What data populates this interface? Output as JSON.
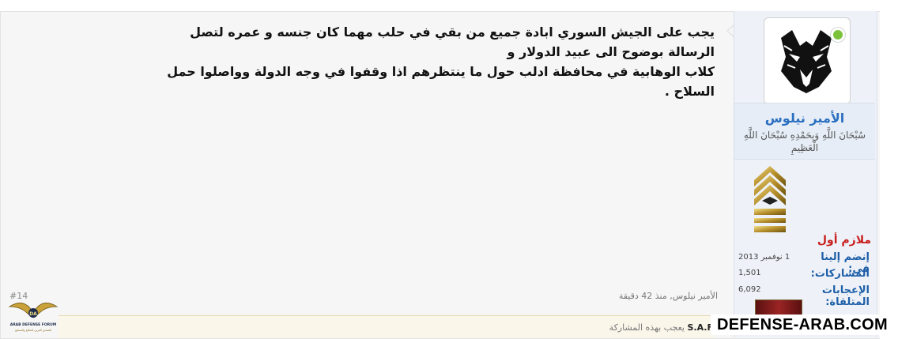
{
  "post": {
    "message_line1": "يجب على الجيش السوري ابادة جميع من بقي في حلب مهما كان جنسه و عمره لتصل الرسالة بوضوح الى عبيد الدولار و",
    "message_line2": "كلاب الوهابية في محافظة ادلب حول ما ينتظرهم اذا وقفوا في وجه الدولة وواصلوا حمل السلاح .",
    "post_number": "#14",
    "author_time": "الأمير نيلوس, منذ 42 دقيقة",
    "likes_user": "S.A.F",
    "likes_suffix": "يعجب بهذه المشاركة"
  },
  "user": {
    "name": "الأمير نيلوس",
    "title": "سُبْحَانَ اللَّهِ وَبِحَمْدِهِ سُبْحَانَ اللَّهِ الْعَظِيمِ",
    "rank": "ملازم أول",
    "stats": {
      "joined_label": "إنضم إلينا في:",
      "joined_value": "1 نوفمبر 2013",
      "posts_label": "المشاركات:",
      "posts_value": "1,501",
      "likes_label": "الإعجابات المتلقاة:",
      "likes_value": "6,092"
    },
    "online": true
  },
  "branding": {
    "watermark": "DEFENSE-ARAB.COM",
    "logo_text": "ARAB DEFENSE FORUM",
    "logo_subtext": "المنتدى العربي للدفاع والتسليح",
    "logo_abbr": "DA"
  },
  "colors": {
    "username": "#2b6fc0",
    "rank": "#c81e1e",
    "stat_label": "#1e5fa8",
    "online": "#7cc13a"
  }
}
